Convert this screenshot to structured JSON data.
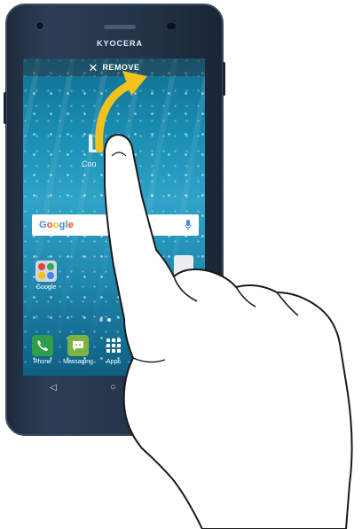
{
  "device": {
    "brand": "KYOCERA"
  },
  "screen": {
    "remove_bar": {
      "icon": "close-x-icon",
      "label": "REMOVE"
    },
    "lock_clock_fragment": "L",
    "lock_date_fragment": "Con",
    "search_widget": {
      "logo_text": "Google",
      "mic_icon": "microphone-icon"
    },
    "home_apps": [
      {
        "label": "Google",
        "icon": "google-folder-icon"
      }
    ],
    "dock": [
      {
        "label": "Phone",
        "icon": "phone-icon",
        "color": "#2e9e48"
      },
      {
        "label": "Messaging",
        "icon": "messaging-icon",
        "color": "#7cb342"
      },
      {
        "label": "Apps",
        "icon": "apps-grid-icon"
      }
    ],
    "nav_keys": [
      {
        "name": "back",
        "glyph": "◁"
      },
      {
        "name": "home",
        "glyph": "○"
      }
    ]
  },
  "gesture": {
    "type": "drag-to-remove",
    "arrow_color": "#f2c21a"
  }
}
